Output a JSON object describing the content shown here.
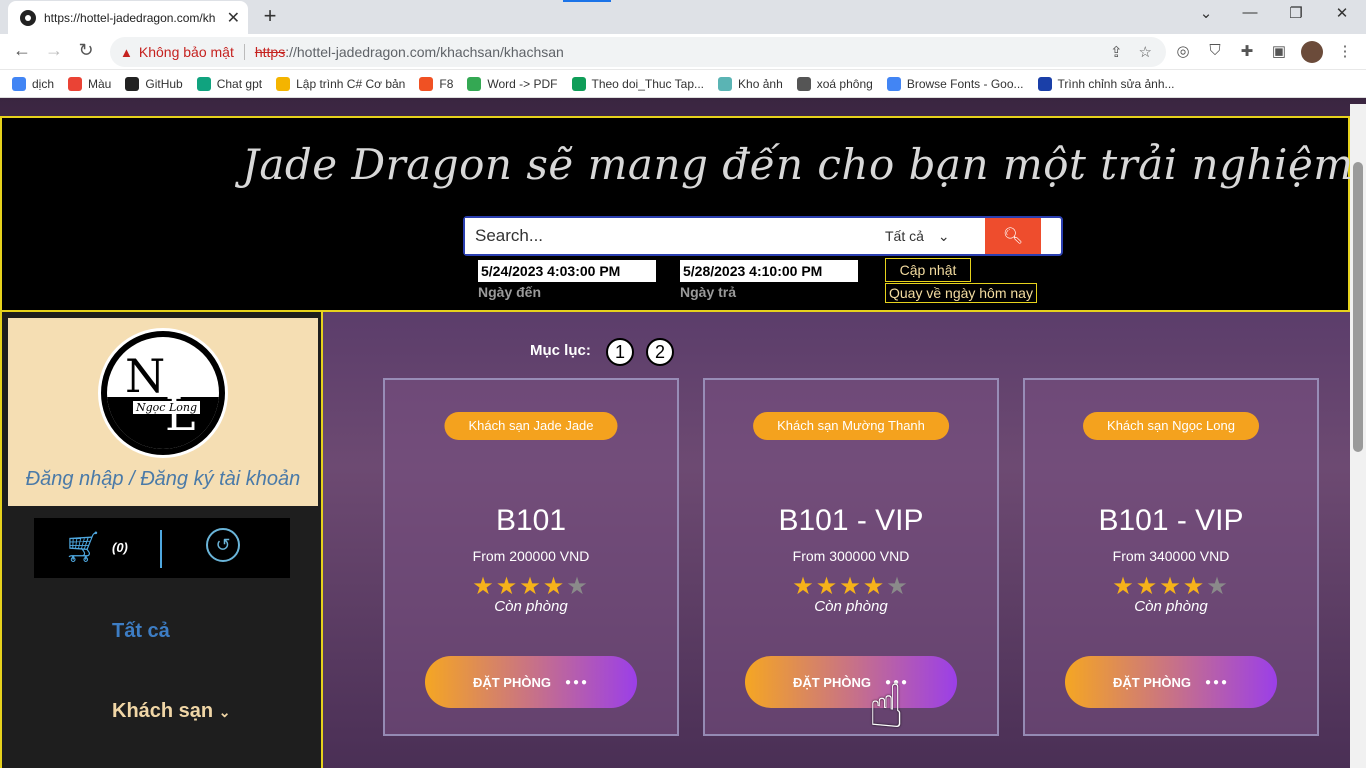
{
  "browser": {
    "tab_title": "https://hottel-jadedragon.com/kh",
    "insecure_label": "Không bảo mật",
    "url_scheme": "https",
    "url_rest": "://hottel-jadedragon.com/khachsan/khachsan"
  },
  "bookmarks": [
    {
      "label": "dịch",
      "color": "#4285f4"
    },
    {
      "label": "Màu",
      "color": "#ea4335"
    },
    {
      "label": "GitHub",
      "color": "#222222"
    },
    {
      "label": "Chat gpt",
      "color": "#10a37f"
    },
    {
      "label": "Lập trình C# Cơ bản",
      "color": "#f4b400"
    },
    {
      "label": "F8",
      "color": "#f05123"
    },
    {
      "label": "Word -> PDF",
      "color": "#34a853"
    },
    {
      "label": "Theo doi_Thuc Tap...",
      "color": "#0f9d58"
    },
    {
      "label": "Kho ảnh",
      "color": "#5ab4b4"
    },
    {
      "label": "xoá phông",
      "color": "#555555"
    },
    {
      "label": "Browse Fonts - Goo...",
      "color": "#4285f4"
    },
    {
      "label": "Trình chỉnh sửa ảnh...",
      "color": "#1a3fa8"
    }
  ],
  "hero": {
    "slogan": "Jade Dragon sẽ mang đến cho bạn một trải nghiệm tuyệt vời",
    "search_placeholder": "Search...",
    "filter_value": "Tất cả",
    "checkin_value": "5/24/2023 4:03:00 PM",
    "checkin_label": "Ngày đến",
    "checkout_value": "5/28/2023 4:10:00 PM",
    "checkout_label": "Ngày trả",
    "update_label": "Cập nhật",
    "today_label": "Quay về ngày hôm nay"
  },
  "sidebar": {
    "login_label": "Đăng nhập / Đăng ký tài khoản",
    "logo_text": "Ngọc Long",
    "cart_count": "(0)",
    "menu_all": "Tất cả",
    "menu_hotels": "Khách sạn"
  },
  "toc": {
    "label": "Mục lục:",
    "pages": [
      "1",
      "2"
    ]
  },
  "cards": [
    {
      "hotel": "Khách sạn Jade Jade",
      "room": "B101",
      "price": "From 200000 VND",
      "rating": 4,
      "status": "Còn phòng",
      "book": "ĐẶT PHÒNG"
    },
    {
      "hotel": "Khách sạn Mường Thanh",
      "room": "B101 - VIP",
      "price": "From 300000 VND",
      "rating": 4,
      "status": "Còn phòng",
      "book": "ĐẶT PHÒNG"
    },
    {
      "hotel": "Khách sạn Ngọc Long",
      "room": "B101 - VIP",
      "price": "From 340000 VND",
      "rating": 4,
      "status": "Còn phòng",
      "book": "ĐẶT PHÒNG"
    }
  ]
}
